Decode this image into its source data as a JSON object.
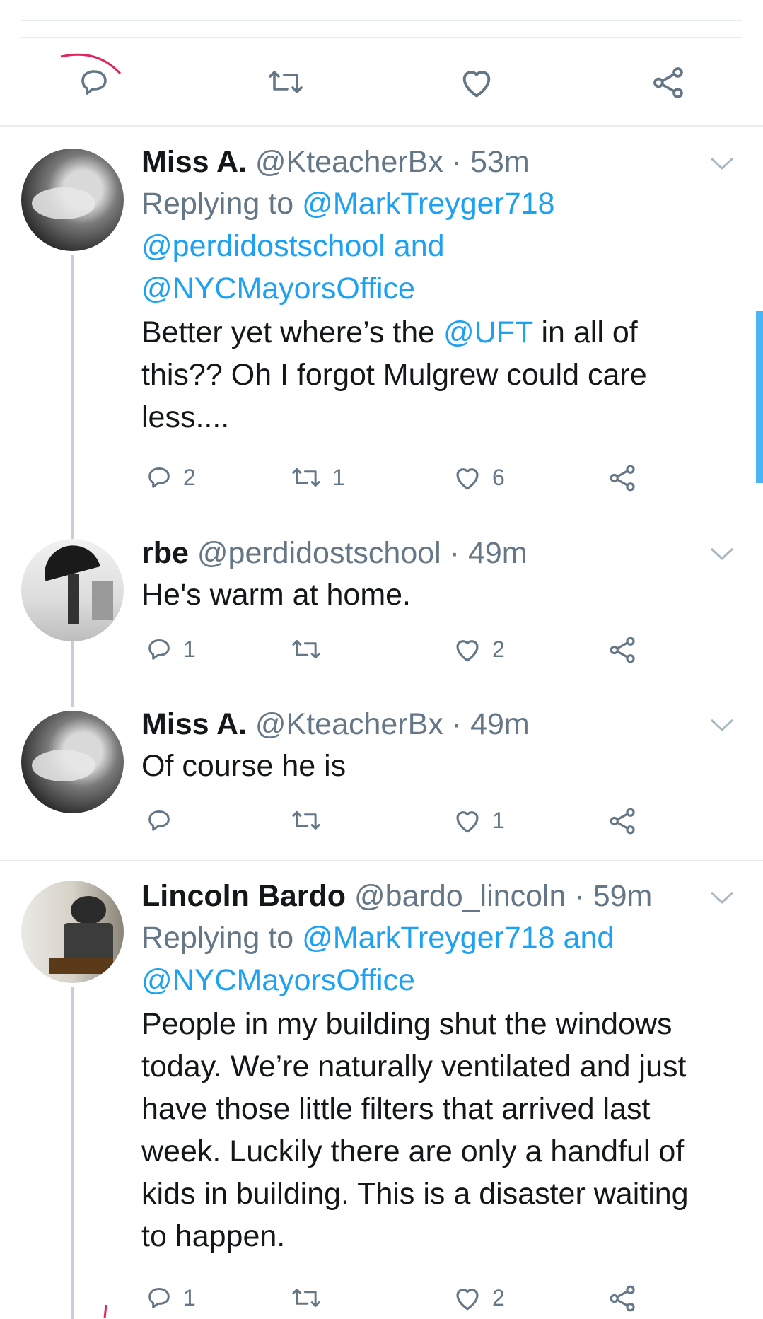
{
  "top_actions": {
    "reply_icon": "reply-icon",
    "retweet_icon": "retweet-icon",
    "like_icon": "heart-icon",
    "share_icon": "share-icon"
  },
  "tweets": [
    {
      "name": "Miss A.",
      "handle": "@KteacherBx",
      "time": "53m",
      "replying_prefix": "Replying to",
      "replying_1": "@MarkTreyger718",
      "replying_2": "@perdidostschool",
      "replying_and": "and",
      "replying_3": "@NYCMayorsOffice",
      "body_1": "Better yet where’s the",
      "body_mention": "@UFT",
      "body_2": "in all of",
      "body_3": "this?? Oh I forgot Mulgrew could care",
      "body_4": "less....",
      "replies": "2",
      "retweets": "1",
      "likes": "6"
    },
    {
      "name": "rbe",
      "handle": "@perdidostschool",
      "time": "49m",
      "body_1": "He's warm at home.",
      "replies": "1",
      "retweets": "",
      "likes": "2"
    },
    {
      "name": "Miss A.",
      "handle": "@KteacherBx",
      "time": "49m",
      "body_1": "Of course he is",
      "replies": "",
      "retweets": "",
      "likes": "1"
    },
    {
      "name": "Lincoln Bardo",
      "handle": "@bardo_lincoln",
      "time": "59m",
      "replying_prefix": "Replying to",
      "replying_1": "@MarkTreyger718 and",
      "replying_2": "@NYCMayorsOffice",
      "body_1": "People in my building shut the windows",
      "body_2": "today. We’re naturally ventilated and just",
      "body_3": "have those little filters that arrived last",
      "body_4": "week. Luckily there are only a handful of",
      "body_5": "kids in building. This is a disaster waiting",
      "body_6": "to happen.",
      "replies": "1",
      "retweets": "",
      "likes": "2"
    }
  ],
  "colors": {
    "link": "#1da1f2",
    "secondary": "#657786",
    "divider": "#e6ecf0",
    "annotation": "#e0245e"
  }
}
